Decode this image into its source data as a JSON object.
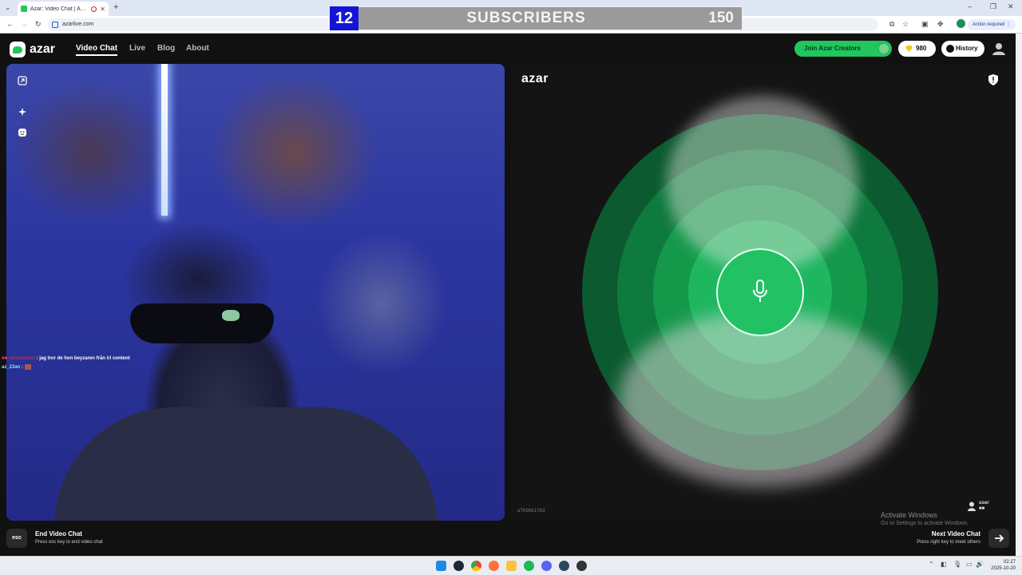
{
  "browser": {
    "tab_title": "Azar: Video Chat | Automati",
    "tab_close": "✕",
    "new_tab": "+",
    "url": "azarlive.com",
    "action_required": "Action required"
  },
  "overlay": {
    "number": "12",
    "label": "SUBSCRIBERS",
    "count": "150"
  },
  "nav": {
    "logo": "azar",
    "items": [
      "Video Chat",
      "Live",
      "Blog",
      "About"
    ],
    "join_label": "Join Azar Creators",
    "gems": "980",
    "history": "History"
  },
  "left_video": {
    "chat": [
      {
        "user": "■■ xxxxxxxxxxx",
        "text": ": jag tror de hon beyzaren från irl content"
      },
      {
        "user": "az_23an",
        "text": ":"
      }
    ]
  },
  "right_panel": {
    "logo": "azar",
    "session_id": "aTK8bk1Yb3",
    "user_label": "user",
    "user_flag": "■■"
  },
  "bottom": {
    "esc": "esc",
    "end_title": "End Video Chat",
    "end_sub": "Press esc key to end video chat",
    "next_title": "Next Video Chat",
    "next_sub": "Press right key to meet others",
    "activate_title": "Activate Windows",
    "activate_sub": "Go to Settings to activate Windows."
  },
  "taskbar": {
    "time": "02:27",
    "date": "2025-10-20"
  },
  "colors": {
    "accent": "#22c55e",
    "overlay_blue": "#1414d6"
  }
}
